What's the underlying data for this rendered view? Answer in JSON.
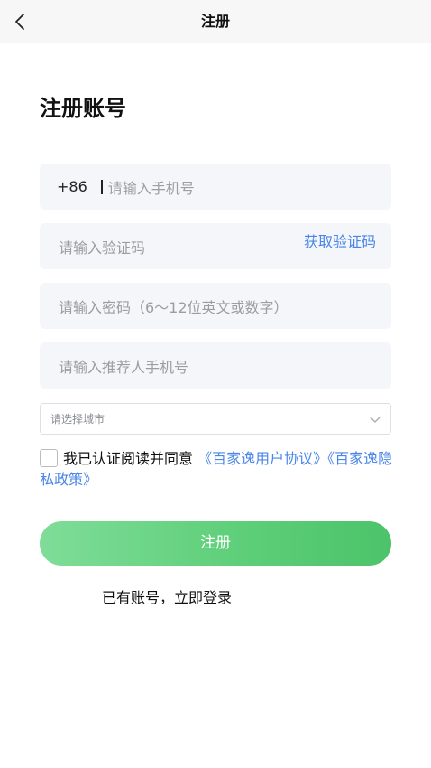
{
  "header": {
    "title": "注册",
    "back_icon": "chevron-left-icon"
  },
  "page_title": "注册账号",
  "phone_field": {
    "country_code": "+86",
    "placeholder": "请输入手机号"
  },
  "code_field": {
    "placeholder": "请输入验证码",
    "get_code_label": "获取验证码"
  },
  "password_field": {
    "placeholder": "请输入密码（6～12位英文或数字）"
  },
  "referrer_field": {
    "placeholder": "请输入推荐人手机号"
  },
  "city_select": {
    "placeholder": "请选择城市",
    "icon": "chevron-down-icon"
  },
  "agreement": {
    "checked": false,
    "prefix": "我已认证阅读并同意",
    "user_agreement": "《百家逸用户协议》",
    "privacy_policy": "《百家逸隐私政策》"
  },
  "submit_label": "注册",
  "login_link": "已有账号，立即登录",
  "colors": {
    "accent_green": "#4cc36a",
    "link_blue": "#4a86e8",
    "field_bg": "#f4f6fa",
    "header_bg": "#f7f7f7"
  }
}
